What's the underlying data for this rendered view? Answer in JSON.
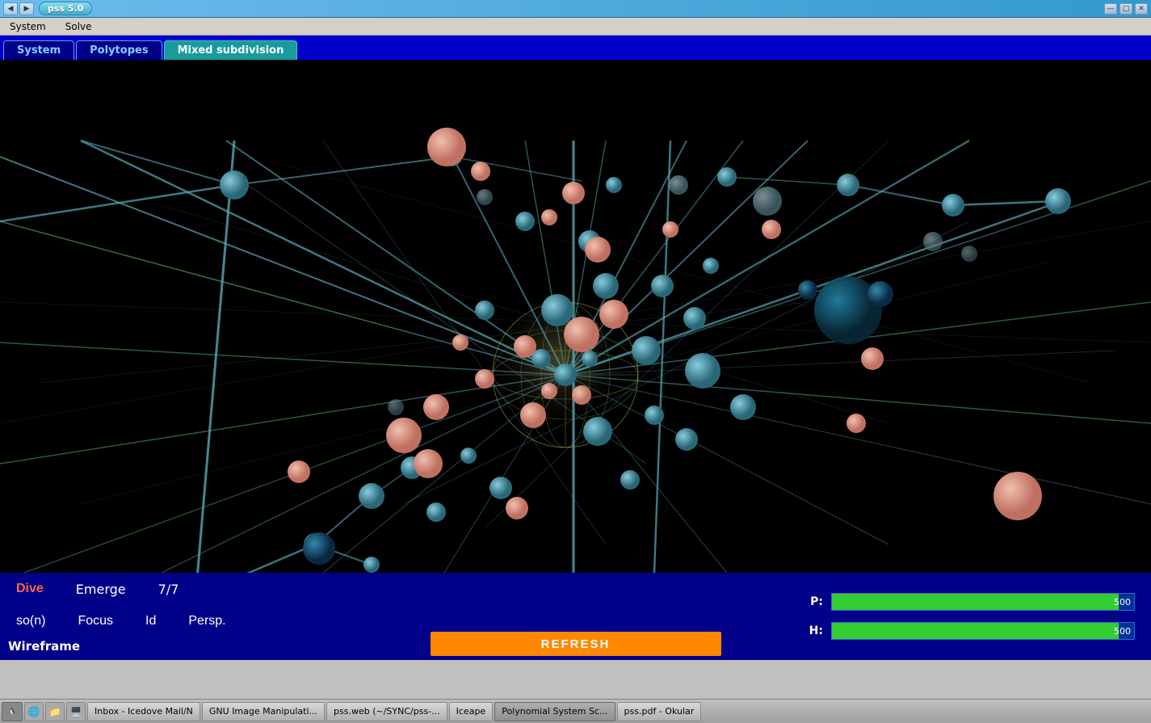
{
  "titlebar": {
    "app_name": "pss 5.0",
    "minimize_label": "—",
    "maximize_label": "□",
    "close_label": "✕"
  },
  "menubar": {
    "items": [
      "System",
      "Solve"
    ]
  },
  "tabs": [
    {
      "id": "system",
      "label": "System",
      "active": false
    },
    {
      "id": "polytopes",
      "label": "Polytopes",
      "active": false
    },
    {
      "id": "mixed-subdivision",
      "label": "Mixed subdivision",
      "active": true
    }
  ],
  "controls": {
    "dive_label": "Dive",
    "emerge_label": "Emerge",
    "status_label": "7/7",
    "so_n_label": "so(n)",
    "focus_label": "Focus",
    "id_label": "Id",
    "persp_label": "Persp.",
    "wireframe_label": "Wireframe",
    "refresh_label": "REFRESH"
  },
  "progress_bars": [
    {
      "id": "p",
      "label": "P:",
      "value": 500,
      "max": 500,
      "fill_pct": 95
    },
    {
      "id": "h",
      "label": "H:",
      "value": 500,
      "max": 500,
      "fill_pct": 95
    }
  ],
  "taskbar": {
    "items": [
      {
        "id": "inbox",
        "label": "Inbox - Icedove Mail/N",
        "active": false
      },
      {
        "id": "gimp",
        "label": "GNU Image Manipulati...",
        "active": false
      },
      {
        "id": "pssweb",
        "label": "pss.web (~/SYNC/pss-...",
        "active": false
      },
      {
        "id": "iceape",
        "label": "Iceape",
        "active": false
      },
      {
        "id": "polynom",
        "label": "Polynomial System Sc...",
        "active": true
      },
      {
        "id": "psspdf",
        "label": "pss.pdf - Okular",
        "active": false
      }
    ]
  },
  "viz": {
    "node_color_teal": "#5ba8b8",
    "node_color_salmon": "#e8a090",
    "node_color_blue": "#1a6688",
    "edge_color": "#5ba8b8",
    "center_sphere_color": "#b8c870"
  }
}
